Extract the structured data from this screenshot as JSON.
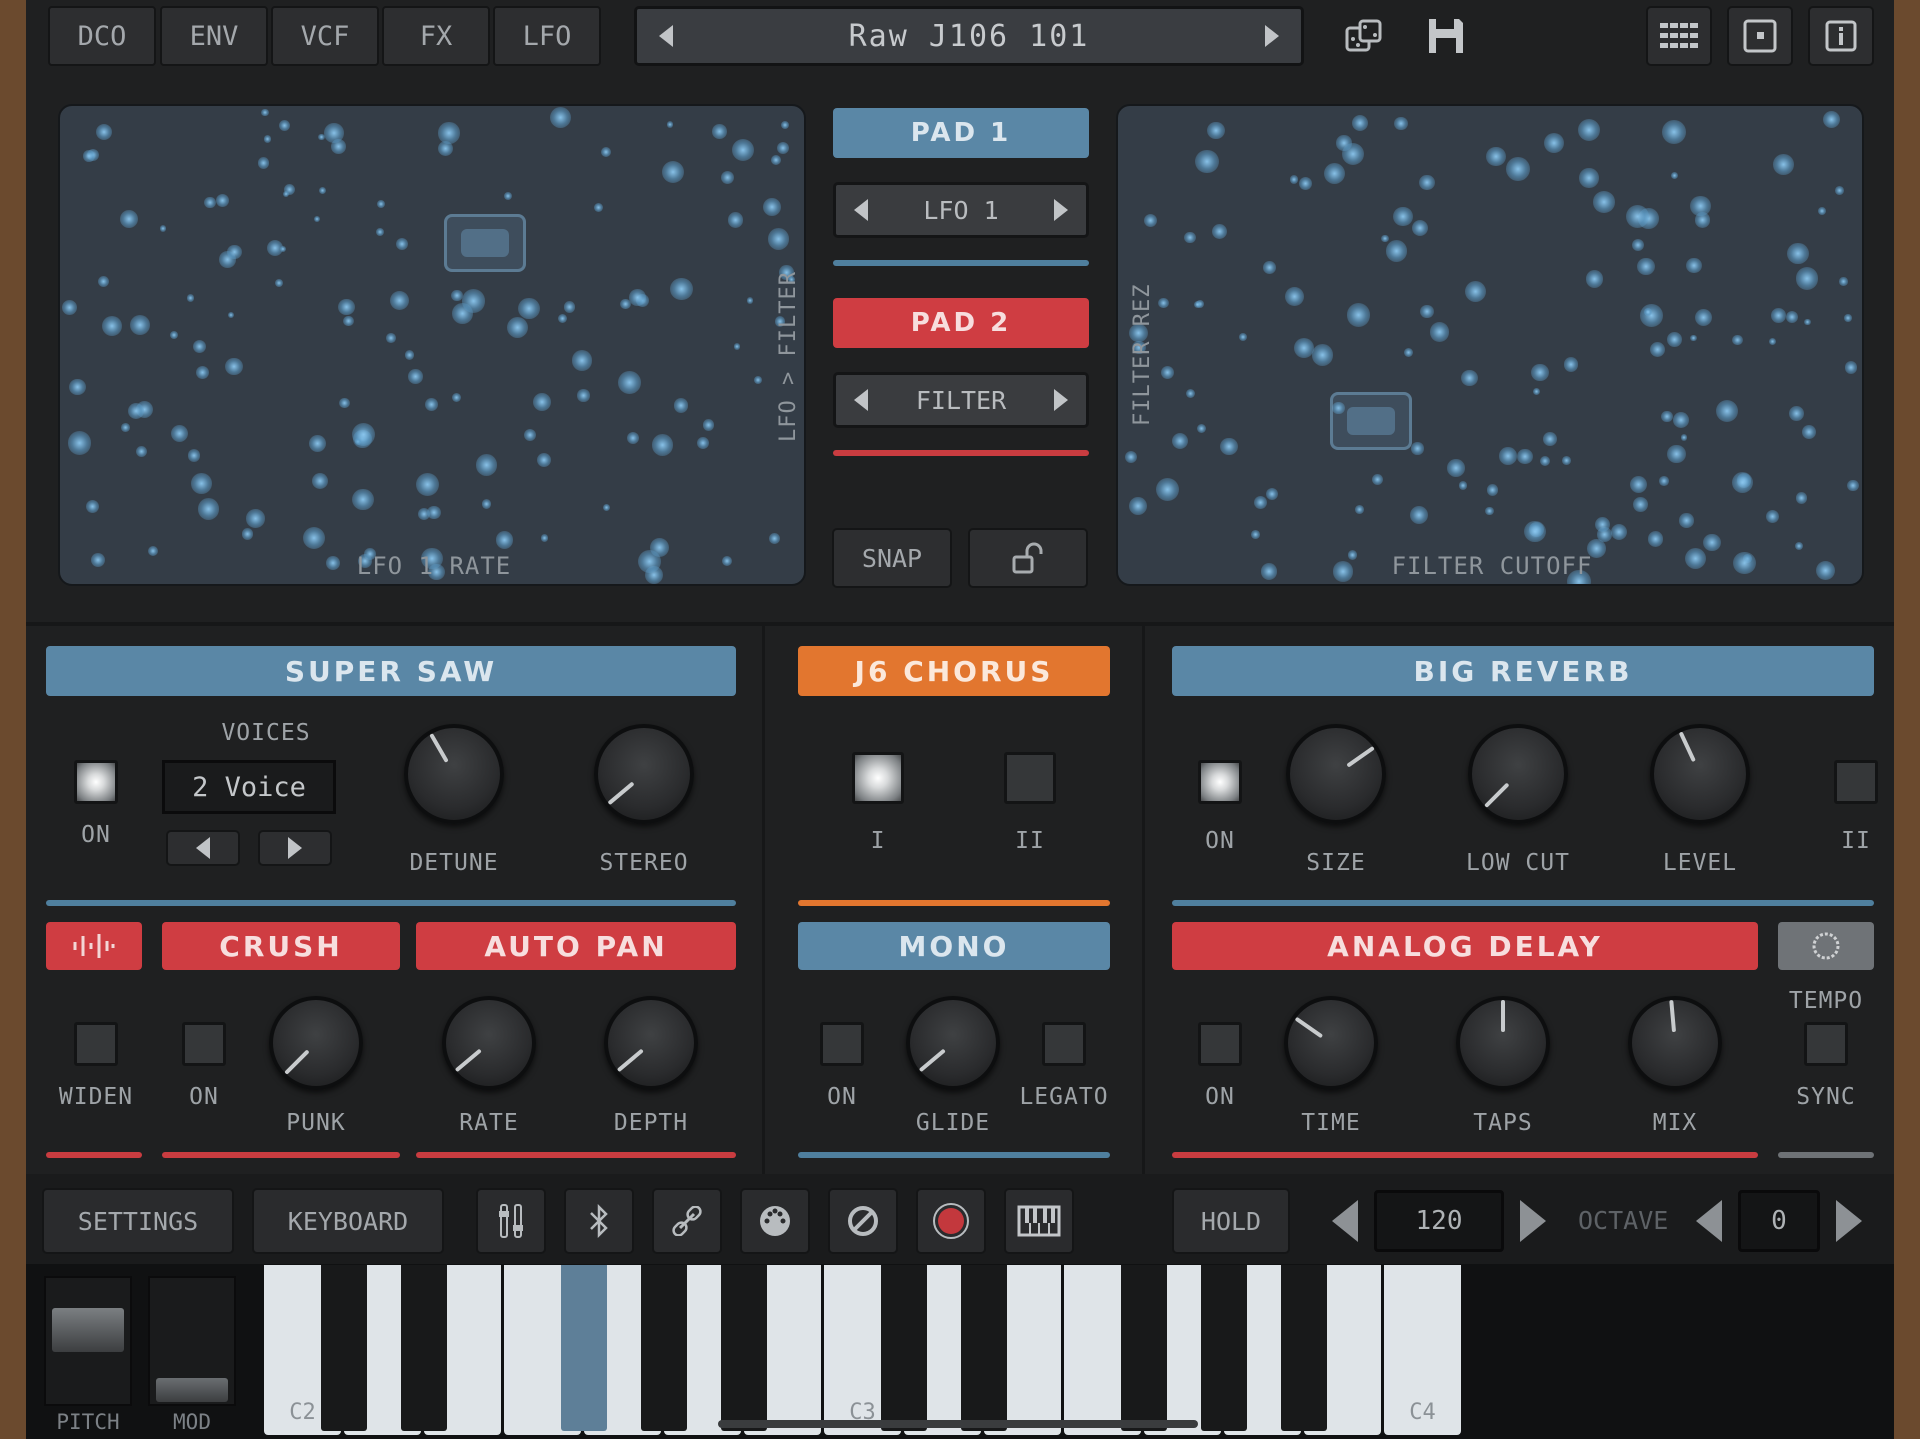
{
  "toolbar": {
    "tabs": [
      "DCO",
      "ENV",
      "VCF",
      "FX",
      "LFO"
    ],
    "preset_name": "Raw J106 101"
  },
  "pads": {
    "left": {
      "x_label": "LFO 1 RATE",
      "y_label": "LFO > FILTER"
    },
    "right": {
      "x_label": "FILTER CUTOFF",
      "y_label": "FILTER REZ"
    },
    "pad1": {
      "title": "PAD 1",
      "target": "LFO 1"
    },
    "pad2": {
      "title": "PAD 2",
      "target": "FILTER"
    },
    "snap_label": "SNAP"
  },
  "super_saw": {
    "title": "SUPER SAW",
    "on_label": "ON",
    "voices_label": "VOICES",
    "voices_value": "2 Voice",
    "detune_label": "DETUNE",
    "stereo_label": "STEREO"
  },
  "chorus": {
    "title": "J6 CHORUS",
    "mode1": "I",
    "mode2": "II"
  },
  "reverb": {
    "title": "BIG REVERB",
    "on_label": "ON",
    "size_label": "SIZE",
    "lowcut_label": "LOW CUT",
    "level_label": "LEVEL",
    "mode_label": "II"
  },
  "crush": {
    "title": "CRUSH",
    "widen_label": "WIDEN",
    "on_label": "ON",
    "punk_label": "PUNK"
  },
  "auto_pan": {
    "title": "AUTO PAN",
    "rate_label": "RATE",
    "depth_label": "DEPTH"
  },
  "mono": {
    "title": "MONO",
    "on_label": "ON",
    "glide_label": "GLIDE",
    "legato_label": "LEGATO"
  },
  "delay": {
    "title": "ANALOG DELAY",
    "on_label": "ON",
    "time_label": "TIME",
    "taps_label": "TAPS",
    "mix_label": "MIX",
    "tempo_label": "TEMPO",
    "sync_label": "SYNC"
  },
  "bottom_bar": {
    "settings": "SETTINGS",
    "keyboard": "KEYBOARD",
    "hold": "HOLD",
    "tempo_value": "120",
    "octave_label": "OCTAVE",
    "octave_value": "0"
  },
  "keyboard": {
    "pitch_label": "PITCH",
    "mod_label": "MOD",
    "note_labels": {
      "c2": "C2",
      "c3": "C3",
      "c4": "C4"
    }
  },
  "colors": {
    "blue": "#5a87a6",
    "red": "#cf3d42",
    "orange": "#e2762f",
    "panel": "#1f2021",
    "pad_bg": "#343d47"
  }
}
